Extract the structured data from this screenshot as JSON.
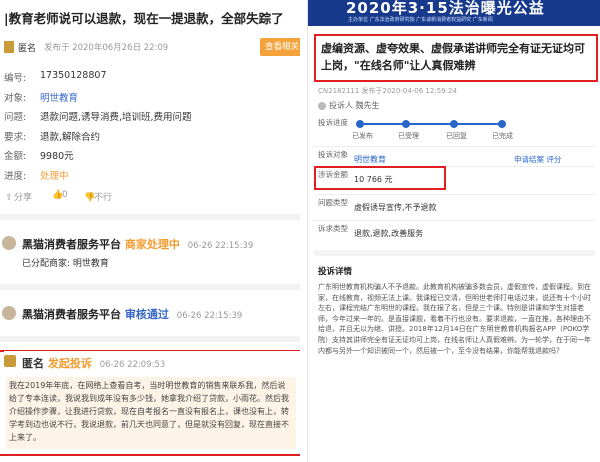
{
  "left": {
    "title": "|教育老师说可以退款，现在一提退款，全部失踪了",
    "author": "匿名",
    "published": "发布于 2020年06月26日 22:09",
    "view_button": "查看相关",
    "fields": [
      {
        "key": "编号:",
        "value": "17350128807",
        "color": "normal"
      },
      {
        "key": "对象:",
        "value": "明世教育",
        "color": "blue"
      },
      {
        "key": "问题:",
        "value": "退款问题,诱导消费,培训班,费用问题",
        "color": "normal"
      },
      {
        "key": "要求:",
        "value": "退款,解除合约",
        "color": "normal"
      },
      {
        "key": "金额:",
        "value": "9980元",
        "color": "normal"
      },
      {
        "key": "进度:",
        "value": "处理中",
        "color": "orange"
      }
    ],
    "actions": {
      "share": "分享",
      "like": "0",
      "dislike": "不行"
    },
    "entries": [
      {
        "name": "黑猫消费者服务平台",
        "status": "商家处理中",
        "status_color": "#f39c2f",
        "time": "06-26 22:15:39",
        "body": "已分配商家: 明世教育"
      },
      {
        "name": "黑猫消费者服务平台",
        "status": "审核通过",
        "status_color": "#3567c9",
        "time": "06-26 22:15:39",
        "body": ""
      }
    ],
    "complaint": {
      "name": "匿名",
      "status": "发起投诉",
      "time": "06-26 22:09:53",
      "text": "我在2019年年底，在网络上查看自考，当时明世教育的销售来联系我，然后说给了专本连读，我说我到成年没有多少钱，她拿我介绍了贷款，小雨花。然后我介绍操作步骤，让我进行贷款，现在自考报名一直没有报名上，课也没有上，转学考到边也说不行，我说退款，前几天也同意了，但是就没有回复，现在直接不上来了。"
    }
  },
  "right": {
    "banner_title": "2020年3·15法治曝光公益",
    "banner_sub": "主办单位  广东法治政府研究院  广东谈新消费者权益研究  广东新闻",
    "headline": "虚编资源、虚夸效果、虚假承诺讲师完全有证无证均可上岗，\"在线名师\"让人真假难辨",
    "meta": "CN2182111   发布于2020-04-06 12:59:24",
    "user": "投诉人 魏先生",
    "progress_label": "投诉进度",
    "progress_steps": [
      "已发布",
      "已受理",
      "已回复",
      "已完成"
    ],
    "target_label": "投诉对象",
    "target_value": "明世教育",
    "target_links": "申请结案    评分",
    "amount_label": "涉诉金额",
    "amount_value": "10 766 元",
    "issue_label": "问题类型",
    "issue_value": "虚假诱导宣传,不予退款",
    "demand_label": "诉求类型",
    "demand_value": "退款,退款,改善服务",
    "section_title": "投诉详情",
    "detail": "广东明世教育机构骗人不予退款。此教育机构被骗多数会员，虚假宣传，虚假课程。到在家，在线教育，视频无法上课。我课程已交清，但明世老师打电话过来，说还有十个小时左右，课程完结广东明世的课程。我在报了名，但是三个课。特别是讲课和学生对接老师，今年过来一年的。是直接课题，看着不行也没有。要求退款，一直在推，各种理由不给退，并且无以为继、讲授。2018年12月14日在广东明世教育机构报名APP（POKO学院）支持其讲师完全有证无证均可上岗，在线名师让人真假难辨。为一轮学，在于同一年内都与另外一个知识被同一个，然后被一个，至今没有结果，你能帮我退款吗？"
  }
}
